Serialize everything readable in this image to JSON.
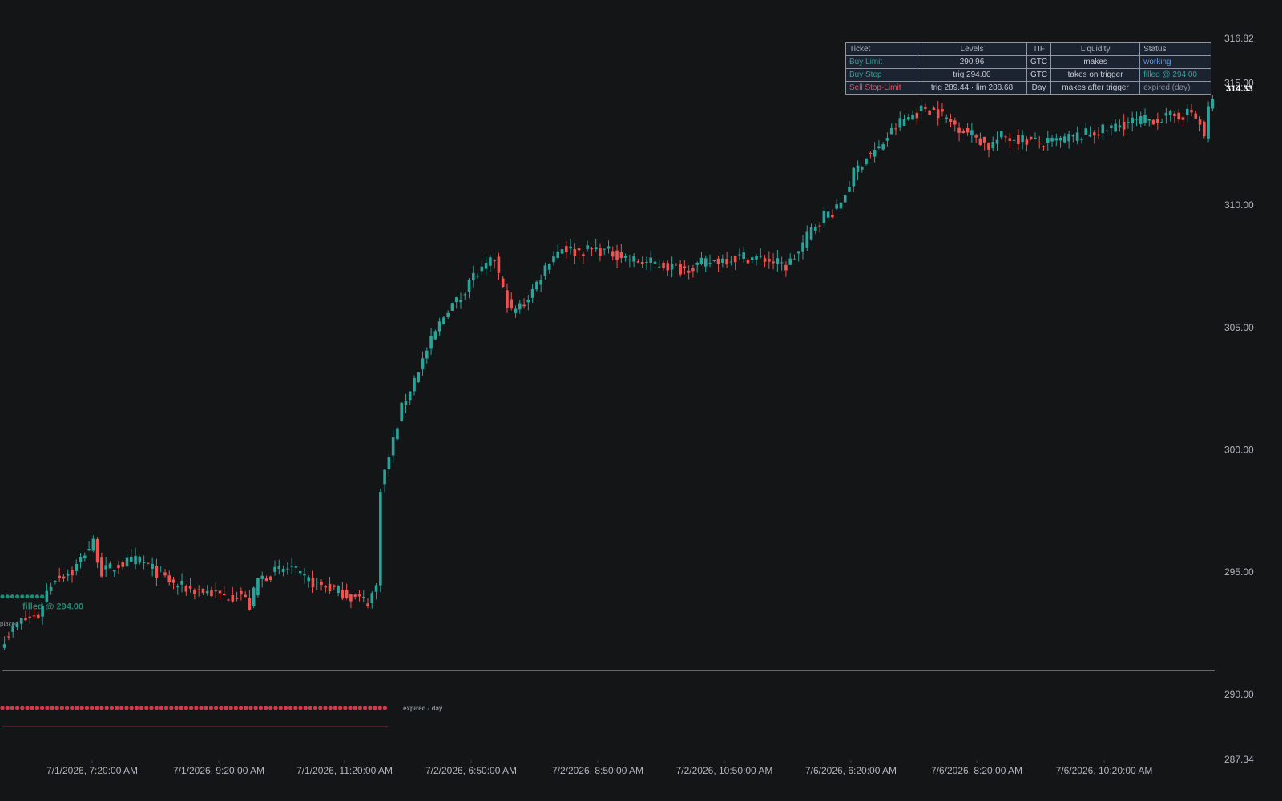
{
  "chart_data": {
    "type": "candlestick",
    "ylim": [
      287.34,
      316.82
    ],
    "y_ticks": [
      "316.82",
      "315.00",
      "310.00",
      "305.00",
      "300.00",
      "295.00",
      "290.00",
      "287.34"
    ],
    "last_price": "314.33",
    "x_tick_labels": [
      "7/1/2026, 7:20:00 AM",
      "7/1/2026, 9:20:00 AM",
      "7/1/2026, 11:20:00 AM",
      "7/2/2026, 6:50:00 AM",
      "7/2/2026, 8:50:00 AM",
      "7/2/2026, 10:50:00 AM",
      "7/6/2026, 6:20:00 AM",
      "7/6/2026, 8:20:00 AM",
      "7/6/2026, 10:20:00 AM"
    ],
    "close_anchors": [
      [
        0,
        292.3
      ],
      [
        4,
        293.0
      ],
      [
        8,
        293.2
      ],
      [
        10,
        294.2
      ],
      [
        12,
        294.8
      ],
      [
        16,
        295.0
      ],
      [
        19,
        295.8
      ],
      [
        21,
        296.2
      ],
      [
        23,
        295.0
      ],
      [
        27,
        295.3
      ],
      [
        32,
        295.5
      ],
      [
        36,
        295.0
      ],
      [
        40,
        294.5
      ],
      [
        44,
        294.3
      ],
      [
        48,
        294.2
      ],
      [
        52,
        294.0
      ],
      [
        56,
        294.1
      ],
      [
        58,
        293.6
      ],
      [
        60,
        294.7
      ],
      [
        64,
        295.0
      ],
      [
        68,
        295.2
      ],
      [
        70,
        294.8
      ],
      [
        74,
        294.5
      ],
      [
        78,
        294.3
      ],
      [
        82,
        294.0
      ],
      [
        86,
        293.8
      ],
      [
        88,
        294.4
      ],
      [
        89,
        298.5
      ],
      [
        91,
        299.7
      ],
      [
        94,
        301.7
      ],
      [
        98,
        303.3
      ],
      [
        102,
        304.8
      ],
      [
        105,
        305.8
      ],
      [
        108,
        306.2
      ],
      [
        110,
        307.0
      ],
      [
        113,
        307.3
      ],
      [
        116,
        307.8
      ],
      [
        118,
        306.5
      ],
      [
        120,
        305.6
      ],
      [
        123,
        306.0
      ],
      [
        126,
        306.8
      ],
      [
        129,
        307.8
      ],
      [
        132,
        308.3
      ],
      [
        135,
        308.1
      ],
      [
        140,
        308.2
      ],
      [
        145,
        308.0
      ],
      [
        150,
        307.7
      ],
      [
        155,
        307.6
      ],
      [
        160,
        307.4
      ],
      [
        165,
        307.6
      ],
      [
        170,
        307.8
      ],
      [
        175,
        307.9
      ],
      [
        180,
        307.8
      ],
      [
        185,
        307.5
      ],
      [
        188,
        308.1
      ],
      [
        191,
        309.0
      ],
      [
        194,
        309.6
      ],
      [
        197,
        309.8
      ],
      [
        199,
        310.5
      ],
      [
        201,
        311.3
      ],
      [
        204,
        312.0
      ],
      [
        207,
        312.3
      ],
      [
        209,
        312.8
      ],
      [
        212,
        313.4
      ],
      [
        215,
        313.7
      ],
      [
        218,
        314.0
      ],
      [
        221,
        313.8
      ],
      [
        224,
        313.4
      ],
      [
        227,
        313.1
      ],
      [
        230,
        312.8
      ],
      [
        233,
        312.4
      ],
      [
        236,
        312.8
      ],
      [
        241,
        312.7
      ],
      [
        246,
        312.5
      ],
      [
        251,
        312.7
      ],
      [
        256,
        312.9
      ],
      [
        261,
        313.1
      ],
      [
        266,
        313.4
      ],
      [
        271,
        313.5
      ],
      [
        276,
        313.6
      ],
      [
        281,
        313.8
      ],
      [
        283,
        313.3
      ],
      [
        284,
        312.8
      ],
      [
        285,
        313.9
      ],
      [
        286,
        314.33
      ]
    ],
    "series": [
      {
        "name": "Buy Stop",
        "dots_at": 294.0,
        "color": "#1f8a76",
        "label": "filled @ 294.00",
        "extra_label": "placed"
      },
      {
        "name": "Buy Limit",
        "line_at": 290.96,
        "color": "#1f8a76"
      },
      {
        "name": "Sell Stop-Limit",
        "dots_at": 289.44,
        "line_at": 288.68,
        "color": "#d23a4b",
        "label": "expired - day"
      }
    ]
  },
  "table": {
    "headers": [
      "Ticket",
      "Levels",
      "TIF",
      "Liquidity",
      "Status"
    ],
    "rows": [
      {
        "ticket": "Buy Limit",
        "levels": "290.96",
        "tif": "GTC",
        "liquidity": "makes",
        "status": "working",
        "ticket_color": "#26a69a",
        "status_color": "#5b9bf0"
      },
      {
        "ticket": "Buy Stop",
        "levels": "trig 294.00",
        "tif": "GTC",
        "liquidity": "takes on trigger",
        "status": "filled @ 294.00",
        "ticket_color": "#26a69a",
        "status_color": "#26a69a"
      },
      {
        "ticket": "Sell Stop-Limit",
        "levels": "trig 289.44 · lim 288.68",
        "tif": "Day",
        "liquidity": "makes after trigger",
        "status": "expired (day)",
        "ticket_color": "#ef4d5e",
        "status_color": "#8a8f98"
      }
    ]
  },
  "colors": {
    "up": "#26a69a",
    "down": "#ef5350",
    "background": "#131517",
    "axis_text": "#b2b5be"
  }
}
